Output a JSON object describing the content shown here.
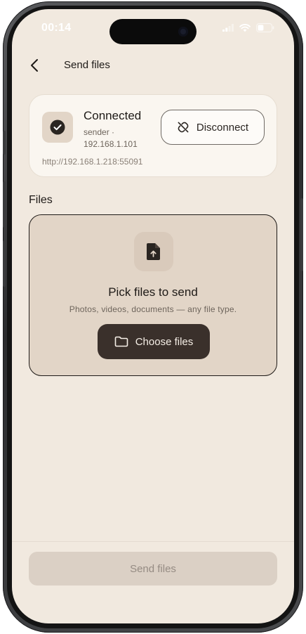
{
  "status_bar": {
    "time": "00:14"
  },
  "header": {
    "title": "Send files",
    "back_icon": "chevron-left-icon"
  },
  "connection": {
    "status": "Connected",
    "device_line": "sender · 192.168.1.101",
    "url": "http://192.168.1.218:55091",
    "disconnect_label": "Disconnect",
    "status_icon": "check-circle-icon",
    "disconnect_icon": "unlink-icon"
  },
  "files": {
    "section_label": "Files",
    "drop_title": "Pick files to send",
    "drop_subtitle": "Photos, videos, documents — any file type.",
    "choose_label": "Choose files",
    "drop_icon": "file-upload-icon",
    "choose_icon": "folder-icon"
  },
  "footer": {
    "send_label": "Send files",
    "send_enabled": false
  },
  "colors": {
    "background": "#f1e9df",
    "card": "#faf6f0",
    "accent_dark": "#3a302b",
    "drop_zone": "#e2d5c7",
    "disabled_button": "#dbd0c5"
  }
}
